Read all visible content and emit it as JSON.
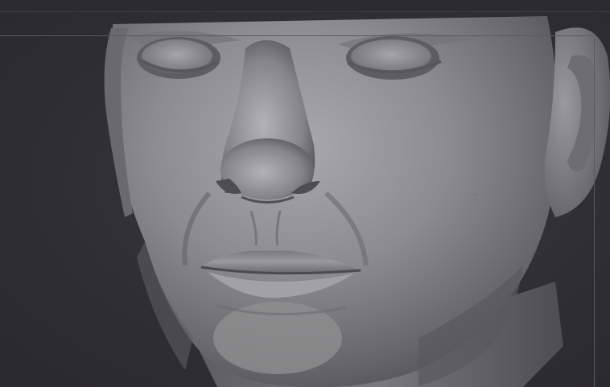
{
  "app": {
    "mode": "sculpt-viewport"
  },
  "viewport": {
    "subject_icon": "sculpted-head-model",
    "background_color": "#2e2d2f",
    "clay_color": "#8a8a8c"
  },
  "cursor": {
    "icon": "crosshair-icon"
  }
}
